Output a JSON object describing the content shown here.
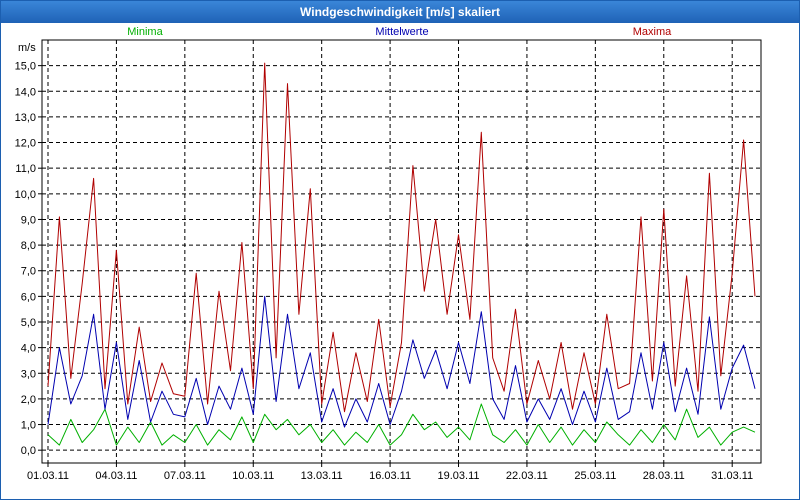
{
  "window": {
    "title": "Windgeschwindigkeit [m/s] skaliert"
  },
  "chart_data": {
    "type": "line",
    "title": "Windgeschwindigkeit [m/s] skaliert",
    "ylabel": "m/s",
    "ylim": [
      -0.5,
      16.0
    ],
    "yticks": [
      "0,0",
      "1,0",
      "2,0",
      "3,0",
      "4,0",
      "5,0",
      "6,0",
      "7,0",
      "8,0",
      "9,0",
      "10,0",
      "11,0",
      "12,0",
      "13,0",
      "14,0",
      "15,0"
    ],
    "xlim": [
      0,
      31
    ],
    "xticks": [
      "01.03.11",
      "04.03.11",
      "07.03.11",
      "10.03.11",
      "13.03.11",
      "16.03.11",
      "19.03.11",
      "22.03.11",
      "25.03.11",
      "28.03.11",
      "31.03.11"
    ],
    "grid": true,
    "legend_position": "top",
    "series": [
      {
        "name": "Minima",
        "color": "#00b000",
        "x": [
          0,
          0.5,
          1,
          1.5,
          2,
          2.5,
          3,
          3.5,
          4,
          4.5,
          5,
          5.5,
          6,
          6.5,
          7,
          7.5,
          8,
          8.5,
          9,
          9.5,
          10,
          10.5,
          11,
          11.5,
          12,
          12.5,
          13,
          13.5,
          14,
          14.5,
          15,
          15.5,
          16,
          16.5,
          17,
          17.5,
          18,
          18.5,
          19,
          19.5,
          20,
          20.5,
          21,
          21.5,
          22,
          22.5,
          23,
          23.5,
          24,
          24.5,
          25,
          25.5,
          26,
          26.5,
          27,
          27.5,
          28,
          28.5,
          29,
          29.5,
          30,
          30.5,
          31
        ],
        "values": [
          0.6,
          0.2,
          1.2,
          0.3,
          0.8,
          1.6,
          0.2,
          0.9,
          0.3,
          1.1,
          0.2,
          0.6,
          0.3,
          1.0,
          0.2,
          0.8,
          0.4,
          1.3,
          0.3,
          1.4,
          0.8,
          1.2,
          0.6,
          1.0,
          0.3,
          0.8,
          0.2,
          0.7,
          0.3,
          1.0,
          0.2,
          0.6,
          1.4,
          0.8,
          1.1,
          0.5,
          0.9,
          0.4,
          1.8,
          0.6,
          0.3,
          0.8,
          0.2,
          1.0,
          0.3,
          0.9,
          0.2,
          0.8,
          0.3,
          1.1,
          0.6,
          0.2,
          0.8,
          0.3,
          1.0,
          0.4,
          1.6,
          0.5,
          0.9,
          0.2,
          0.7,
          0.9,
          0.7
        ]
      },
      {
        "name": "Mittelwerte",
        "color": "#0000b0",
        "x": [
          0,
          0.5,
          1,
          1.5,
          2,
          2.5,
          3,
          3.5,
          4,
          4.5,
          5,
          5.5,
          6,
          6.5,
          7,
          7.5,
          8,
          8.5,
          9,
          9.5,
          10,
          10.5,
          11,
          11.5,
          12,
          12.5,
          13,
          13.5,
          14,
          14.5,
          15,
          15.5,
          16,
          16.5,
          17,
          17.5,
          18,
          18.5,
          19,
          19.5,
          20,
          20.5,
          21,
          21.5,
          22,
          22.5,
          23,
          23.5,
          24,
          24.5,
          25,
          25.5,
          26,
          26.5,
          27,
          27.5,
          28,
          28.5,
          29,
          29.5,
          30,
          30.5,
          31
        ],
        "values": [
          1.0,
          4.0,
          1.8,
          2.9,
          5.3,
          1.6,
          4.2,
          1.2,
          3.5,
          1.1,
          2.3,
          1.4,
          1.3,
          2.8,
          1.0,
          2.5,
          1.6,
          3.2,
          1.4,
          6.0,
          1.9,
          5.3,
          2.4,
          3.8,
          1.1,
          2.4,
          0.9,
          2.0,
          1.1,
          2.6,
          1.0,
          2.3,
          4.3,
          2.8,
          3.9,
          2.4,
          4.2,
          2.6,
          5.4,
          2.0,
          1.2,
          3.3,
          1.1,
          2.0,
          1.2,
          2.4,
          1.0,
          2.3,
          1.1,
          3.2,
          1.2,
          1.5,
          3.8,
          1.6,
          4.2,
          1.5,
          3.2,
          1.4,
          5.2,
          1.6,
          3.2,
          4.1,
          2.4
        ]
      },
      {
        "name": "Maxima",
        "color": "#b00000",
        "x": [
          0,
          0.5,
          1,
          1.5,
          2,
          2.5,
          3,
          3.5,
          4,
          4.5,
          5,
          5.5,
          6,
          6.5,
          7,
          7.5,
          8,
          8.5,
          9,
          9.5,
          10,
          10.5,
          11,
          11.5,
          12,
          12.5,
          13,
          13.5,
          14,
          14.5,
          15,
          15.5,
          16,
          16.5,
          17,
          17.5,
          18,
          18.5,
          19,
          19.5,
          20,
          20.5,
          21,
          21.5,
          22,
          22.5,
          23,
          23.5,
          24,
          24.5,
          25,
          25.5,
          26,
          26.5,
          27,
          27.5,
          28,
          28.5,
          29,
          29.5,
          30,
          30.5,
          31
        ],
        "values": [
          2.5,
          9.1,
          2.8,
          6.5,
          10.6,
          2.4,
          7.8,
          1.8,
          4.8,
          1.9,
          3.4,
          2.2,
          2.1,
          6.9,
          1.8,
          6.2,
          3.1,
          8.1,
          2.4,
          15.1,
          3.6,
          14.3,
          5.3,
          10.2,
          1.8,
          4.6,
          1.5,
          3.8,
          1.9,
          5.1,
          1.7,
          4.2,
          11.1,
          6.2,
          9.0,
          5.3,
          8.4,
          5.1,
          12.4,
          3.6,
          2.3,
          5.5,
          1.8,
          3.5,
          2.0,
          4.2,
          1.6,
          3.8,
          1.8,
          5.3,
          2.4,
          2.6,
          9.1,
          2.7,
          9.4,
          2.5,
          6.8,
          2.3,
          10.8,
          2.9,
          6.9,
          12.1,
          6.0
        ]
      }
    ]
  }
}
